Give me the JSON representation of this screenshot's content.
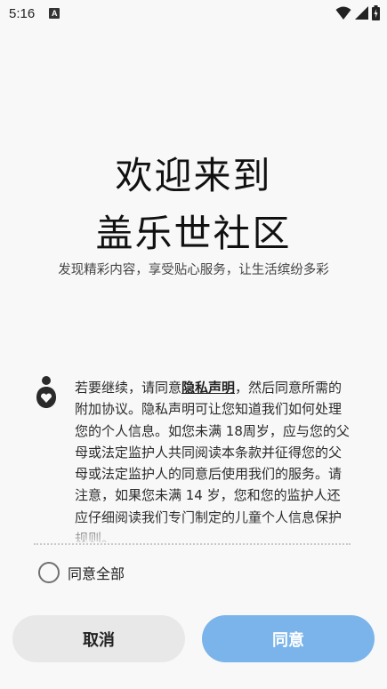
{
  "status_bar": {
    "time": "5:16",
    "notification_badge": "A"
  },
  "welcome": {
    "title_line1": "欢迎来到",
    "title_line2": "盖乐世社区",
    "subtitle": "发现精彩内容，享受贴心服务，让生活缤纷多彩"
  },
  "privacy": {
    "icon": "privacy-shield-icon",
    "text_before": "若要继续，请同意",
    "link_label": "隐私声明",
    "text_after": "，然后同意所需的附加协议。隐私声明可让您知道我们如何处理您的个人信息。如您未满 18周岁，应与您的父母或法定监护人共同阅读本条款并征得您的父母或法定监护人的同意后使用我们的服务。请注意，如果您未满 14 岁，您和您的监护人还应仔细阅读我们专门制定的儿童个人信息保护规则。"
  },
  "agree_all": {
    "label": "同意全部",
    "checked": false
  },
  "buttons": {
    "cancel": "取消",
    "agree": "同意"
  },
  "colors": {
    "background": "#f8f8f8",
    "agree_button": "#7ab4ea",
    "cancel_button": "#e8e8e8"
  }
}
